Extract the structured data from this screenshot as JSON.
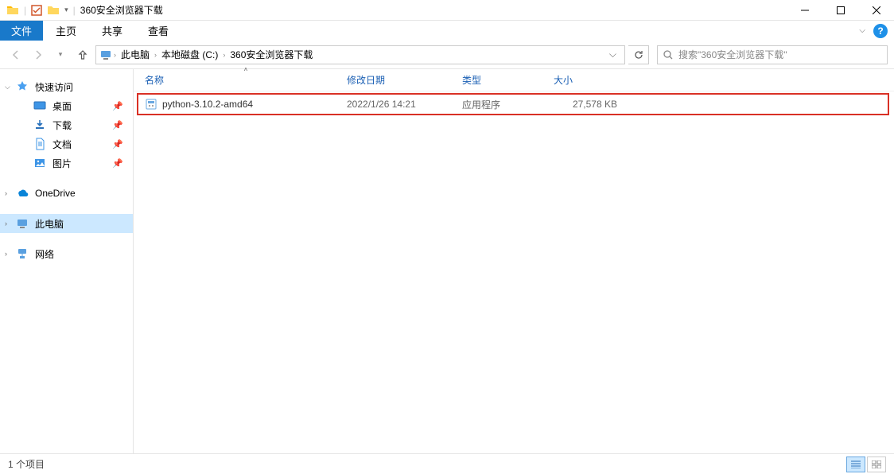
{
  "window": {
    "title": "360安全浏览器下载"
  },
  "menu": {
    "file": "文件",
    "home": "主页",
    "share": "共享",
    "view": "查看"
  },
  "breadcrumbs": [
    "此电脑",
    "本地磁盘 (C:)",
    "360安全浏览器下载"
  ],
  "search": {
    "placeholder": "搜索\"360安全浏览器下载\""
  },
  "columns": {
    "name": "名称",
    "date": "修改日期",
    "type": "类型",
    "size": "大小"
  },
  "sidebar": {
    "quick_access": "快速访问",
    "items": [
      {
        "label": "桌面"
      },
      {
        "label": "下载"
      },
      {
        "label": "文档"
      },
      {
        "label": "图片"
      }
    ],
    "onedrive": "OneDrive",
    "this_pc": "此电脑",
    "network": "网络"
  },
  "files": [
    {
      "name": "python-3.10.2-amd64",
      "date": "2022/1/26 14:21",
      "type": "应用程序",
      "size": "27,578 KB"
    }
  ],
  "status": {
    "count": "1 个项目"
  }
}
